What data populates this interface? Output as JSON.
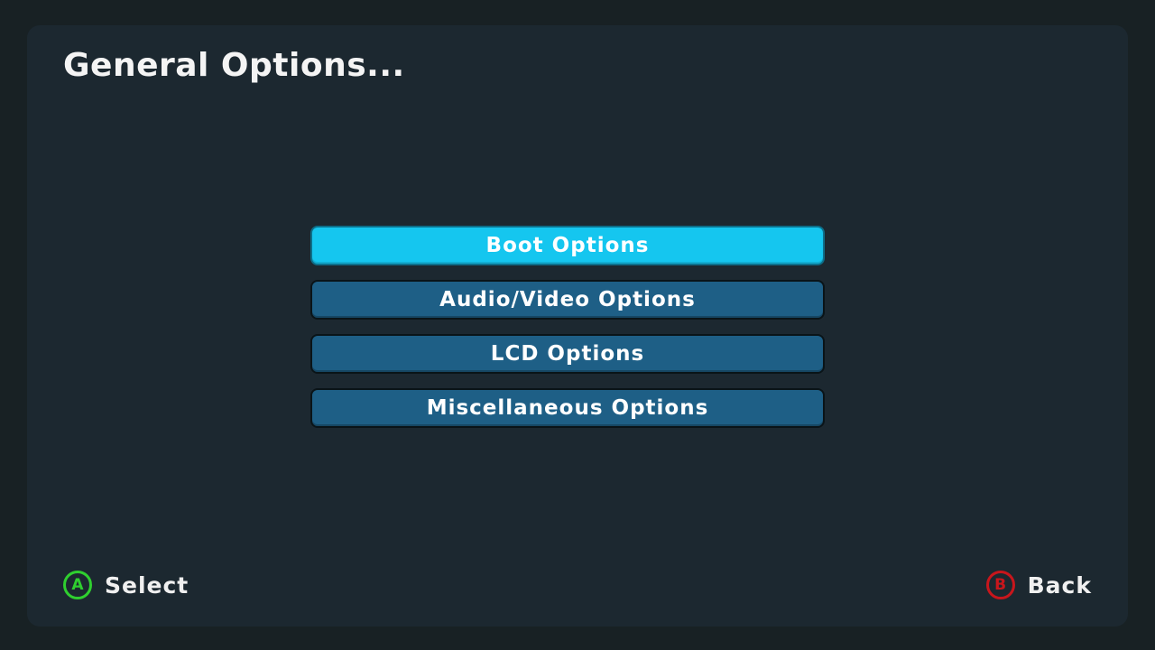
{
  "header": {
    "title": "General Options..."
  },
  "menu": {
    "items": [
      {
        "label": "Boot Options",
        "selected": true
      },
      {
        "label": "Audio/Video Options",
        "selected": false
      },
      {
        "label": "LCD Options",
        "selected": false
      },
      {
        "label": "Miscellaneous Options",
        "selected": false
      }
    ]
  },
  "footer": {
    "select": {
      "button": "A",
      "label": "Select",
      "icon": "a-button-icon",
      "color": "#2fcf2f"
    },
    "back": {
      "button": "B",
      "label": "Back",
      "icon": "b-button-icon",
      "color": "#c8161c"
    }
  },
  "colors": {
    "background": "#182124",
    "panel": "#1c2830",
    "menu_item": "#1e5f86",
    "menu_item_selected": "#15c6ef",
    "text": "#ffffff"
  }
}
